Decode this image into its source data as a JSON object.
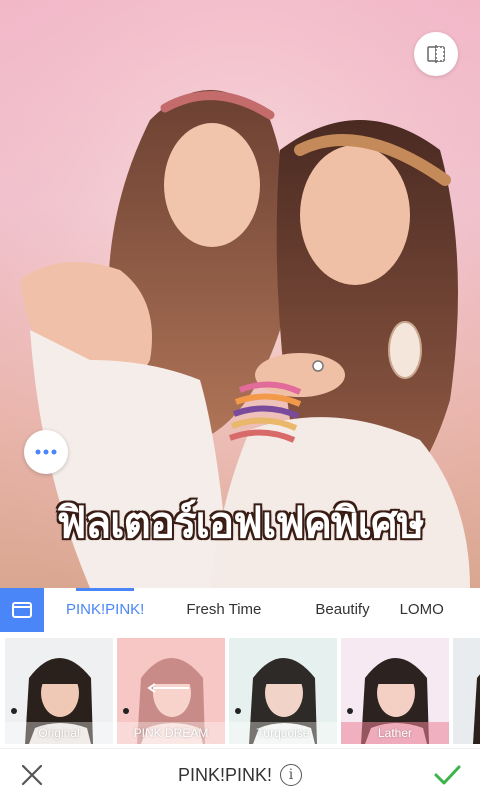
{
  "promo_text": "ฟิลเตอร์เอฟเฟคพิเศษ",
  "filter_tabs": [
    {
      "label": "PINK!PINK!",
      "active": true
    },
    {
      "label": "Fresh Time",
      "active": false
    },
    {
      "label": "Beautify",
      "active": false
    },
    {
      "label": "LOMO",
      "active": false
    }
  ],
  "filters": [
    {
      "label": "Original"
    },
    {
      "label": "PINK DREAM"
    },
    {
      "label": "Turquoise"
    },
    {
      "label": "Lather"
    }
  ],
  "bottom_bar": {
    "title": "PINK!PINK!",
    "info_glyph": "i"
  },
  "colors": {
    "accent": "#4a86f7",
    "confirm": "#3cb44b"
  },
  "icons": {
    "compare": "compare-icon",
    "more": "more-dots-icon",
    "filter_category": "filter-category-icon",
    "close": "close-icon",
    "check": "check-icon",
    "info": "info-icon"
  }
}
